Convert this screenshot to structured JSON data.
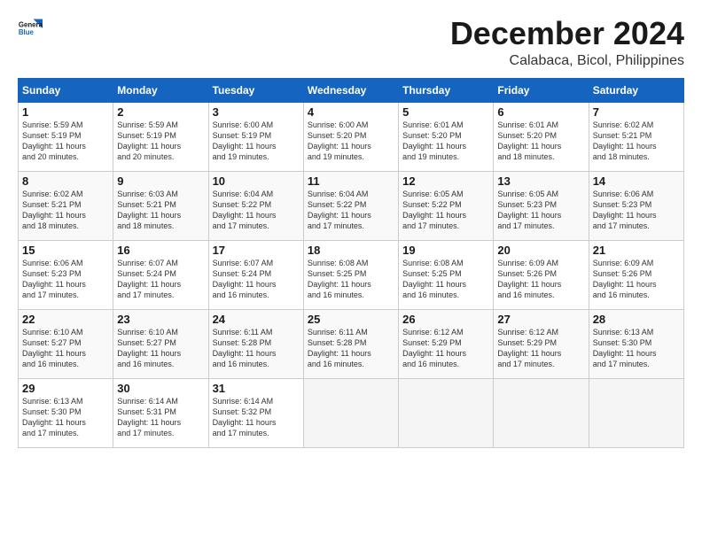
{
  "header": {
    "logo_line1": "General",
    "logo_line2": "Blue",
    "month": "December 2024",
    "location": "Calabaca, Bicol, Philippines"
  },
  "days_of_week": [
    "Sunday",
    "Monday",
    "Tuesday",
    "Wednesday",
    "Thursday",
    "Friday",
    "Saturday"
  ],
  "weeks": [
    [
      {
        "day": "1",
        "info": "Sunrise: 5:59 AM\nSunset: 5:19 PM\nDaylight: 11 hours\nand 20 minutes."
      },
      {
        "day": "2",
        "info": "Sunrise: 5:59 AM\nSunset: 5:19 PM\nDaylight: 11 hours\nand 20 minutes."
      },
      {
        "day": "3",
        "info": "Sunrise: 6:00 AM\nSunset: 5:19 PM\nDaylight: 11 hours\nand 19 minutes."
      },
      {
        "day": "4",
        "info": "Sunrise: 6:00 AM\nSunset: 5:20 PM\nDaylight: 11 hours\nand 19 minutes."
      },
      {
        "day": "5",
        "info": "Sunrise: 6:01 AM\nSunset: 5:20 PM\nDaylight: 11 hours\nand 19 minutes."
      },
      {
        "day": "6",
        "info": "Sunrise: 6:01 AM\nSunset: 5:20 PM\nDaylight: 11 hours\nand 18 minutes."
      },
      {
        "day": "7",
        "info": "Sunrise: 6:02 AM\nSunset: 5:21 PM\nDaylight: 11 hours\nand 18 minutes."
      }
    ],
    [
      {
        "day": "8",
        "info": "Sunrise: 6:02 AM\nSunset: 5:21 PM\nDaylight: 11 hours\nand 18 minutes."
      },
      {
        "day": "9",
        "info": "Sunrise: 6:03 AM\nSunset: 5:21 PM\nDaylight: 11 hours\nand 18 minutes."
      },
      {
        "day": "10",
        "info": "Sunrise: 6:04 AM\nSunset: 5:22 PM\nDaylight: 11 hours\nand 17 minutes."
      },
      {
        "day": "11",
        "info": "Sunrise: 6:04 AM\nSunset: 5:22 PM\nDaylight: 11 hours\nand 17 minutes."
      },
      {
        "day": "12",
        "info": "Sunrise: 6:05 AM\nSunset: 5:22 PM\nDaylight: 11 hours\nand 17 minutes."
      },
      {
        "day": "13",
        "info": "Sunrise: 6:05 AM\nSunset: 5:23 PM\nDaylight: 11 hours\nand 17 minutes."
      },
      {
        "day": "14",
        "info": "Sunrise: 6:06 AM\nSunset: 5:23 PM\nDaylight: 11 hours\nand 17 minutes."
      }
    ],
    [
      {
        "day": "15",
        "info": "Sunrise: 6:06 AM\nSunset: 5:23 PM\nDaylight: 11 hours\nand 17 minutes."
      },
      {
        "day": "16",
        "info": "Sunrise: 6:07 AM\nSunset: 5:24 PM\nDaylight: 11 hours\nand 17 minutes."
      },
      {
        "day": "17",
        "info": "Sunrise: 6:07 AM\nSunset: 5:24 PM\nDaylight: 11 hours\nand 16 minutes."
      },
      {
        "day": "18",
        "info": "Sunrise: 6:08 AM\nSunset: 5:25 PM\nDaylight: 11 hours\nand 16 minutes."
      },
      {
        "day": "19",
        "info": "Sunrise: 6:08 AM\nSunset: 5:25 PM\nDaylight: 11 hours\nand 16 minutes."
      },
      {
        "day": "20",
        "info": "Sunrise: 6:09 AM\nSunset: 5:26 PM\nDaylight: 11 hours\nand 16 minutes."
      },
      {
        "day": "21",
        "info": "Sunrise: 6:09 AM\nSunset: 5:26 PM\nDaylight: 11 hours\nand 16 minutes."
      }
    ],
    [
      {
        "day": "22",
        "info": "Sunrise: 6:10 AM\nSunset: 5:27 PM\nDaylight: 11 hours\nand 16 minutes."
      },
      {
        "day": "23",
        "info": "Sunrise: 6:10 AM\nSunset: 5:27 PM\nDaylight: 11 hours\nand 16 minutes."
      },
      {
        "day": "24",
        "info": "Sunrise: 6:11 AM\nSunset: 5:28 PM\nDaylight: 11 hours\nand 16 minutes."
      },
      {
        "day": "25",
        "info": "Sunrise: 6:11 AM\nSunset: 5:28 PM\nDaylight: 11 hours\nand 16 minutes."
      },
      {
        "day": "26",
        "info": "Sunrise: 6:12 AM\nSunset: 5:29 PM\nDaylight: 11 hours\nand 16 minutes."
      },
      {
        "day": "27",
        "info": "Sunrise: 6:12 AM\nSunset: 5:29 PM\nDaylight: 11 hours\nand 17 minutes."
      },
      {
        "day": "28",
        "info": "Sunrise: 6:13 AM\nSunset: 5:30 PM\nDaylight: 11 hours\nand 17 minutes."
      }
    ],
    [
      {
        "day": "29",
        "info": "Sunrise: 6:13 AM\nSunset: 5:30 PM\nDaylight: 11 hours\nand 17 minutes."
      },
      {
        "day": "30",
        "info": "Sunrise: 6:14 AM\nSunset: 5:31 PM\nDaylight: 11 hours\nand 17 minutes."
      },
      {
        "day": "31",
        "info": "Sunrise: 6:14 AM\nSunset: 5:32 PM\nDaylight: 11 hours\nand 17 minutes."
      },
      {
        "day": "",
        "info": ""
      },
      {
        "day": "",
        "info": ""
      },
      {
        "day": "",
        "info": ""
      },
      {
        "day": "",
        "info": ""
      }
    ]
  ]
}
